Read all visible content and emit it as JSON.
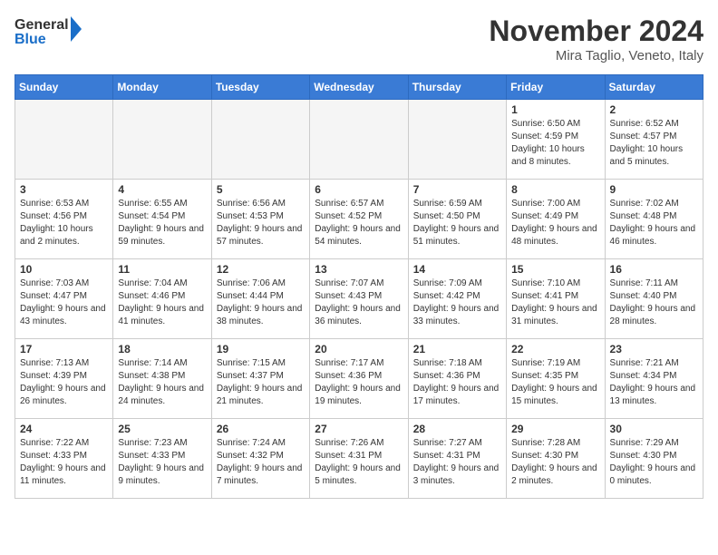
{
  "logo": {
    "line1": "General",
    "line2": "Blue"
  },
  "title": "November 2024",
  "subtitle": "Mira Taglio, Veneto, Italy",
  "days_of_week": [
    "Sunday",
    "Monday",
    "Tuesday",
    "Wednesday",
    "Thursday",
    "Friday",
    "Saturday"
  ],
  "weeks": [
    [
      {
        "day": "",
        "info": "",
        "empty": true
      },
      {
        "day": "",
        "info": "",
        "empty": true
      },
      {
        "day": "",
        "info": "",
        "empty": true
      },
      {
        "day": "",
        "info": "",
        "empty": true
      },
      {
        "day": "",
        "info": "",
        "empty": true
      },
      {
        "day": "1",
        "info": "Sunrise: 6:50 AM\nSunset: 4:59 PM\nDaylight: 10 hours\nand 8 minutes."
      },
      {
        "day": "2",
        "info": "Sunrise: 6:52 AM\nSunset: 4:57 PM\nDaylight: 10 hours\nand 5 minutes."
      }
    ],
    [
      {
        "day": "3",
        "info": "Sunrise: 6:53 AM\nSunset: 4:56 PM\nDaylight: 10 hours\nand 2 minutes."
      },
      {
        "day": "4",
        "info": "Sunrise: 6:55 AM\nSunset: 4:54 PM\nDaylight: 9 hours\nand 59 minutes."
      },
      {
        "day": "5",
        "info": "Sunrise: 6:56 AM\nSunset: 4:53 PM\nDaylight: 9 hours\nand 57 minutes."
      },
      {
        "day": "6",
        "info": "Sunrise: 6:57 AM\nSunset: 4:52 PM\nDaylight: 9 hours\nand 54 minutes."
      },
      {
        "day": "7",
        "info": "Sunrise: 6:59 AM\nSunset: 4:50 PM\nDaylight: 9 hours\nand 51 minutes."
      },
      {
        "day": "8",
        "info": "Sunrise: 7:00 AM\nSunset: 4:49 PM\nDaylight: 9 hours\nand 48 minutes."
      },
      {
        "day": "9",
        "info": "Sunrise: 7:02 AM\nSunset: 4:48 PM\nDaylight: 9 hours\nand 46 minutes."
      }
    ],
    [
      {
        "day": "10",
        "info": "Sunrise: 7:03 AM\nSunset: 4:47 PM\nDaylight: 9 hours\nand 43 minutes."
      },
      {
        "day": "11",
        "info": "Sunrise: 7:04 AM\nSunset: 4:46 PM\nDaylight: 9 hours\nand 41 minutes."
      },
      {
        "day": "12",
        "info": "Sunrise: 7:06 AM\nSunset: 4:44 PM\nDaylight: 9 hours\nand 38 minutes."
      },
      {
        "day": "13",
        "info": "Sunrise: 7:07 AM\nSunset: 4:43 PM\nDaylight: 9 hours\nand 36 minutes."
      },
      {
        "day": "14",
        "info": "Sunrise: 7:09 AM\nSunset: 4:42 PM\nDaylight: 9 hours\nand 33 minutes."
      },
      {
        "day": "15",
        "info": "Sunrise: 7:10 AM\nSunset: 4:41 PM\nDaylight: 9 hours\nand 31 minutes."
      },
      {
        "day": "16",
        "info": "Sunrise: 7:11 AM\nSunset: 4:40 PM\nDaylight: 9 hours\nand 28 minutes."
      }
    ],
    [
      {
        "day": "17",
        "info": "Sunrise: 7:13 AM\nSunset: 4:39 PM\nDaylight: 9 hours\nand 26 minutes."
      },
      {
        "day": "18",
        "info": "Sunrise: 7:14 AM\nSunset: 4:38 PM\nDaylight: 9 hours\nand 24 minutes."
      },
      {
        "day": "19",
        "info": "Sunrise: 7:15 AM\nSunset: 4:37 PM\nDaylight: 9 hours\nand 21 minutes."
      },
      {
        "day": "20",
        "info": "Sunrise: 7:17 AM\nSunset: 4:36 PM\nDaylight: 9 hours\nand 19 minutes."
      },
      {
        "day": "21",
        "info": "Sunrise: 7:18 AM\nSunset: 4:36 PM\nDaylight: 9 hours\nand 17 minutes."
      },
      {
        "day": "22",
        "info": "Sunrise: 7:19 AM\nSunset: 4:35 PM\nDaylight: 9 hours\nand 15 minutes."
      },
      {
        "day": "23",
        "info": "Sunrise: 7:21 AM\nSunset: 4:34 PM\nDaylight: 9 hours\nand 13 minutes."
      }
    ],
    [
      {
        "day": "24",
        "info": "Sunrise: 7:22 AM\nSunset: 4:33 PM\nDaylight: 9 hours\nand 11 minutes."
      },
      {
        "day": "25",
        "info": "Sunrise: 7:23 AM\nSunset: 4:33 PM\nDaylight: 9 hours\nand 9 minutes."
      },
      {
        "day": "26",
        "info": "Sunrise: 7:24 AM\nSunset: 4:32 PM\nDaylight: 9 hours\nand 7 minutes."
      },
      {
        "day": "27",
        "info": "Sunrise: 7:26 AM\nSunset: 4:31 PM\nDaylight: 9 hours\nand 5 minutes."
      },
      {
        "day": "28",
        "info": "Sunrise: 7:27 AM\nSunset: 4:31 PM\nDaylight: 9 hours\nand 3 minutes."
      },
      {
        "day": "29",
        "info": "Sunrise: 7:28 AM\nSunset: 4:30 PM\nDaylight: 9 hours\nand 2 minutes."
      },
      {
        "day": "30",
        "info": "Sunrise: 7:29 AM\nSunset: 4:30 PM\nDaylight: 9 hours\nand 0 minutes."
      }
    ]
  ]
}
